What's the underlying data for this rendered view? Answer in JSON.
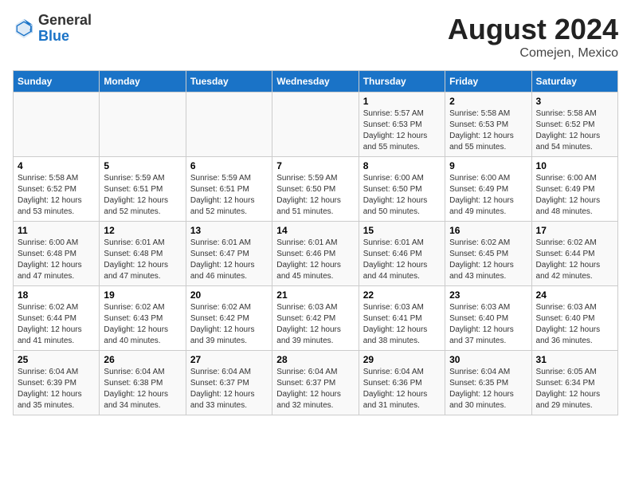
{
  "logo": {
    "general": "General",
    "blue": "Blue"
  },
  "title": "August 2024",
  "subtitle": "Comejen, Mexico",
  "days_of_week": [
    "Sunday",
    "Monday",
    "Tuesday",
    "Wednesday",
    "Thursday",
    "Friday",
    "Saturday"
  ],
  "weeks": [
    [
      {
        "day": "",
        "info": ""
      },
      {
        "day": "",
        "info": ""
      },
      {
        "day": "",
        "info": ""
      },
      {
        "day": "",
        "info": ""
      },
      {
        "day": "1",
        "info": "Sunrise: 5:57 AM\nSunset: 6:53 PM\nDaylight: 12 hours\nand 55 minutes."
      },
      {
        "day": "2",
        "info": "Sunrise: 5:58 AM\nSunset: 6:53 PM\nDaylight: 12 hours\nand 55 minutes."
      },
      {
        "day": "3",
        "info": "Sunrise: 5:58 AM\nSunset: 6:52 PM\nDaylight: 12 hours\nand 54 minutes."
      }
    ],
    [
      {
        "day": "4",
        "info": "Sunrise: 5:58 AM\nSunset: 6:52 PM\nDaylight: 12 hours\nand 53 minutes."
      },
      {
        "day": "5",
        "info": "Sunrise: 5:59 AM\nSunset: 6:51 PM\nDaylight: 12 hours\nand 52 minutes."
      },
      {
        "day": "6",
        "info": "Sunrise: 5:59 AM\nSunset: 6:51 PM\nDaylight: 12 hours\nand 52 minutes."
      },
      {
        "day": "7",
        "info": "Sunrise: 5:59 AM\nSunset: 6:50 PM\nDaylight: 12 hours\nand 51 minutes."
      },
      {
        "day": "8",
        "info": "Sunrise: 6:00 AM\nSunset: 6:50 PM\nDaylight: 12 hours\nand 50 minutes."
      },
      {
        "day": "9",
        "info": "Sunrise: 6:00 AM\nSunset: 6:49 PM\nDaylight: 12 hours\nand 49 minutes."
      },
      {
        "day": "10",
        "info": "Sunrise: 6:00 AM\nSunset: 6:49 PM\nDaylight: 12 hours\nand 48 minutes."
      }
    ],
    [
      {
        "day": "11",
        "info": "Sunrise: 6:00 AM\nSunset: 6:48 PM\nDaylight: 12 hours\nand 47 minutes."
      },
      {
        "day": "12",
        "info": "Sunrise: 6:01 AM\nSunset: 6:48 PM\nDaylight: 12 hours\nand 47 minutes."
      },
      {
        "day": "13",
        "info": "Sunrise: 6:01 AM\nSunset: 6:47 PM\nDaylight: 12 hours\nand 46 minutes."
      },
      {
        "day": "14",
        "info": "Sunrise: 6:01 AM\nSunset: 6:46 PM\nDaylight: 12 hours\nand 45 minutes."
      },
      {
        "day": "15",
        "info": "Sunrise: 6:01 AM\nSunset: 6:46 PM\nDaylight: 12 hours\nand 44 minutes."
      },
      {
        "day": "16",
        "info": "Sunrise: 6:02 AM\nSunset: 6:45 PM\nDaylight: 12 hours\nand 43 minutes."
      },
      {
        "day": "17",
        "info": "Sunrise: 6:02 AM\nSunset: 6:44 PM\nDaylight: 12 hours\nand 42 minutes."
      }
    ],
    [
      {
        "day": "18",
        "info": "Sunrise: 6:02 AM\nSunset: 6:44 PM\nDaylight: 12 hours\nand 41 minutes."
      },
      {
        "day": "19",
        "info": "Sunrise: 6:02 AM\nSunset: 6:43 PM\nDaylight: 12 hours\nand 40 minutes."
      },
      {
        "day": "20",
        "info": "Sunrise: 6:02 AM\nSunset: 6:42 PM\nDaylight: 12 hours\nand 39 minutes."
      },
      {
        "day": "21",
        "info": "Sunrise: 6:03 AM\nSunset: 6:42 PM\nDaylight: 12 hours\nand 39 minutes."
      },
      {
        "day": "22",
        "info": "Sunrise: 6:03 AM\nSunset: 6:41 PM\nDaylight: 12 hours\nand 38 minutes."
      },
      {
        "day": "23",
        "info": "Sunrise: 6:03 AM\nSunset: 6:40 PM\nDaylight: 12 hours\nand 37 minutes."
      },
      {
        "day": "24",
        "info": "Sunrise: 6:03 AM\nSunset: 6:40 PM\nDaylight: 12 hours\nand 36 minutes."
      }
    ],
    [
      {
        "day": "25",
        "info": "Sunrise: 6:04 AM\nSunset: 6:39 PM\nDaylight: 12 hours\nand 35 minutes."
      },
      {
        "day": "26",
        "info": "Sunrise: 6:04 AM\nSunset: 6:38 PM\nDaylight: 12 hours\nand 34 minutes."
      },
      {
        "day": "27",
        "info": "Sunrise: 6:04 AM\nSunset: 6:37 PM\nDaylight: 12 hours\nand 33 minutes."
      },
      {
        "day": "28",
        "info": "Sunrise: 6:04 AM\nSunset: 6:37 PM\nDaylight: 12 hours\nand 32 minutes."
      },
      {
        "day": "29",
        "info": "Sunrise: 6:04 AM\nSunset: 6:36 PM\nDaylight: 12 hours\nand 31 minutes."
      },
      {
        "day": "30",
        "info": "Sunrise: 6:04 AM\nSunset: 6:35 PM\nDaylight: 12 hours\nand 30 minutes."
      },
      {
        "day": "31",
        "info": "Sunrise: 6:05 AM\nSunset: 6:34 PM\nDaylight: 12 hours\nand 29 minutes."
      }
    ]
  ]
}
